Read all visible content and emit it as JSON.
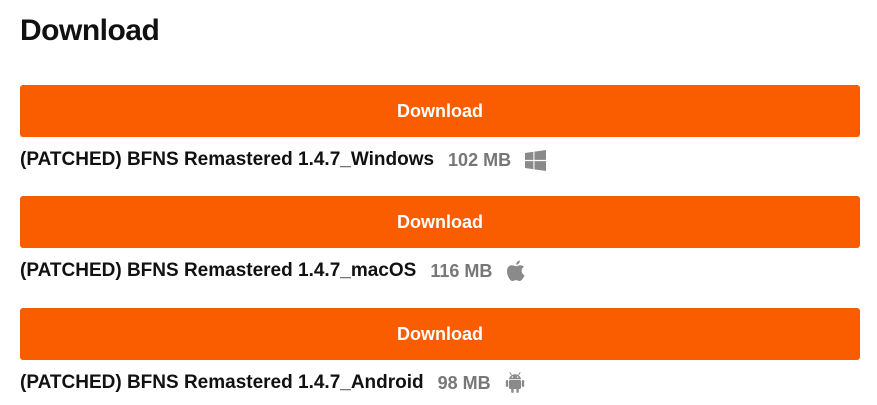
{
  "heading": "Download",
  "downloads": [
    {
      "button_label": "Download",
      "file_name": "(PATCHED) BFNS Remastered 1.4.7_Windows",
      "size": "102 MB",
      "platform_icon": "windows-icon"
    },
    {
      "button_label": "Download",
      "file_name": "(PATCHED) BFNS Remastered 1.4.7_macOS",
      "size": "116 MB",
      "platform_icon": "apple-icon"
    },
    {
      "button_label": "Download",
      "file_name": "(PATCHED) BFNS Remastered 1.4.7_Android",
      "size": "98 MB",
      "platform_icon": "android-icon"
    }
  ],
  "colors": {
    "button_bg": "#fa5c00",
    "button_text": "#ffffff",
    "size_text": "#777777",
    "icon": "#8a8a8a"
  }
}
